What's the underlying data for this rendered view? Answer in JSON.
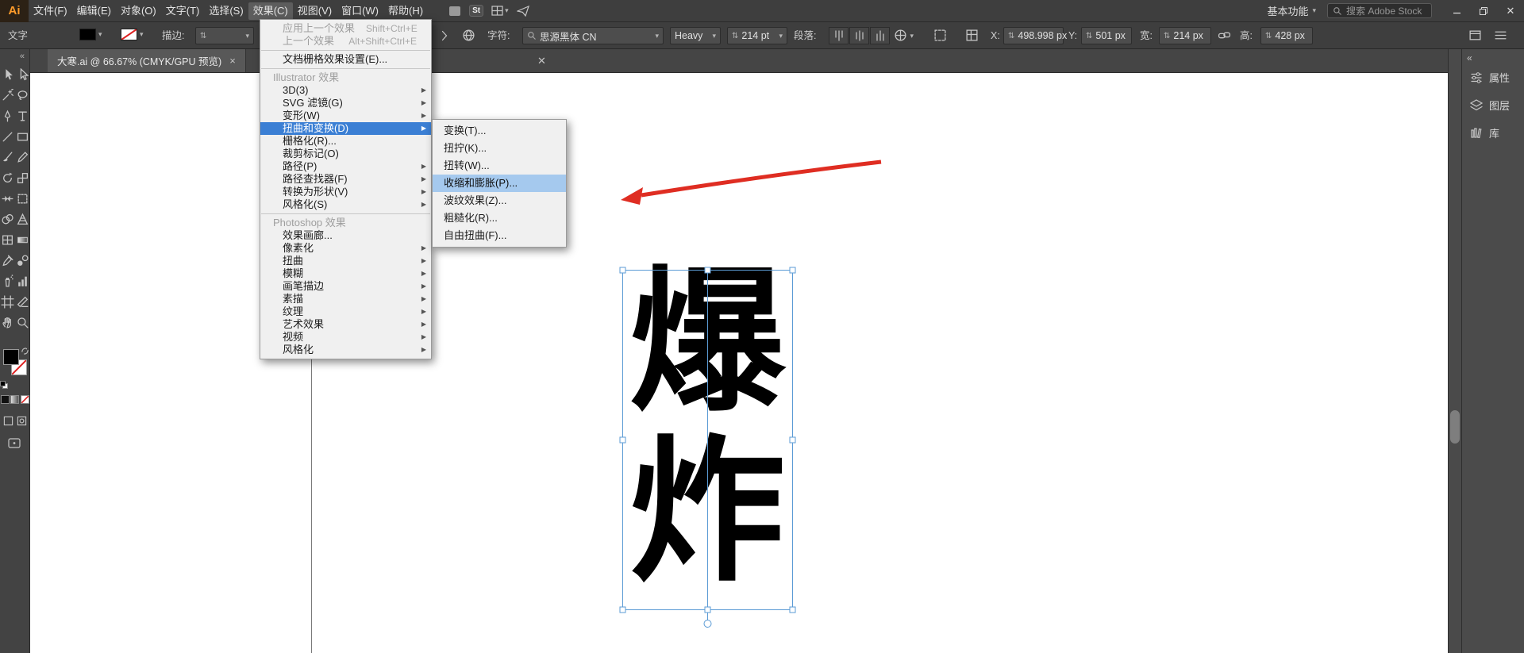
{
  "colors": {
    "menu_highlight": "#3b7fd4",
    "submenu_highlight": "#a5c9ee",
    "arrow_red": "#df2d22",
    "selection_blue": "#5b9bd5"
  },
  "menubar": {
    "logo": "Ai",
    "items": [
      {
        "id": "file",
        "label": "文件(F)"
      },
      {
        "id": "edit",
        "label": "编辑(E)"
      },
      {
        "id": "object",
        "label": "对象(O)"
      },
      {
        "id": "type",
        "label": "文字(T)"
      },
      {
        "id": "select",
        "label": "选择(S)"
      },
      {
        "id": "effect",
        "label": "效果(C)",
        "active": true
      },
      {
        "id": "view",
        "label": "视图(V)"
      },
      {
        "id": "window",
        "label": "窗口(W)"
      },
      {
        "id": "help",
        "label": "帮助(H)"
      }
    ],
    "stock_icon_label": "St",
    "workspace_label": "基本功能",
    "search_placeholder": "搜索 Adobe Stock"
  },
  "controlbar": {
    "context_label": "文字",
    "stroke_label": "描边:",
    "char_label": "字符:",
    "font_name": "思源黑体 CN",
    "font_style": "Heavy",
    "font_size": "214 pt",
    "paragraph_label": "段落:",
    "x_label": "X:",
    "x_value": "498.998 px",
    "y_label": "Y:",
    "y_value": "501 px",
    "w_label": "宽:",
    "w_value": "214 px",
    "h_label": "高:",
    "h_value": "428 px"
  },
  "tabbar": {
    "document_title": "大寒.ai @ 66.67% (CMYK/GPU 预览)"
  },
  "toolbar": {
    "tools": [
      "selection",
      "direct-selection",
      "magic-wand",
      "lasso",
      "pen",
      "type",
      "line-segment",
      "rectangle",
      "paintbrush",
      "pencil",
      "rotate",
      "scale",
      "width",
      "free-transform",
      "shape-builder",
      "perspective-grid",
      "mesh",
      "gradient",
      "eyedropper",
      "blend",
      "symbol-sprayer",
      "column-graph",
      "artboard",
      "slice",
      "hand",
      "zoom"
    ]
  },
  "effect_menu": {
    "items": [
      {
        "id": "apply-last-effect",
        "label": "应用上一个效果",
        "shortcut": "Shift+Ctrl+E",
        "disabled": true
      },
      {
        "id": "last-effect",
        "label": "上一个效果",
        "shortcut": "Alt+Shift+Ctrl+E",
        "disabled": true
      },
      {
        "type": "separator"
      },
      {
        "id": "document-raster-effects-settings",
        "label": "文档栅格效果设置(E)..."
      },
      {
        "type": "separator"
      },
      {
        "type": "header",
        "label": "Illustrator 效果"
      },
      {
        "id": "3d",
        "label": "3D(3)",
        "submenu": true
      },
      {
        "id": "svg-filters",
        "label": "SVG 滤镜(G)",
        "submenu": true
      },
      {
        "id": "warp",
        "label": "变形(W)",
        "submenu": true
      },
      {
        "id": "distort-and-transform",
        "label": "扭曲和变换(D)",
        "submenu": true,
        "selected": true
      },
      {
        "id": "rasterize",
        "label": "栅格化(R)..."
      },
      {
        "id": "crop-marks",
        "label": "裁剪标记(O)"
      },
      {
        "id": "path",
        "label": "路径(P)",
        "submenu": true
      },
      {
        "id": "pathfinder",
        "label": "路径查找器(F)",
        "submenu": true
      },
      {
        "id": "convert-to-shape",
        "label": "转换为形状(V)",
        "submenu": true
      },
      {
        "id": "stylize",
        "label": "风格化(S)",
        "submenu": true
      },
      {
        "type": "separator"
      },
      {
        "type": "header",
        "label": "Photoshop 效果"
      },
      {
        "id": "effect-gallery",
        "label": "效果画廊..."
      },
      {
        "id": "pixelate",
        "label": "像素化",
        "submenu": true
      },
      {
        "id": "distort",
        "label": "扭曲",
        "submenu": true
      },
      {
        "id": "blur",
        "label": "模糊",
        "submenu": true
      },
      {
        "id": "brush-strokes",
        "label": "画笔描边",
        "submenu": true
      },
      {
        "id": "sketch",
        "label": "素描",
        "submenu": true
      },
      {
        "id": "texture",
        "label": "纹理",
        "submenu": true
      },
      {
        "id": "artistic",
        "label": "艺术效果",
        "submenu": true
      },
      {
        "id": "video",
        "label": "视频",
        "submenu": true
      },
      {
        "id": "stylize-ps",
        "label": "风格化",
        "submenu": true
      }
    ]
  },
  "distort_submenu": {
    "items": [
      {
        "id": "transform",
        "label": "变换(T)..."
      },
      {
        "id": "tweak",
        "label": "扭拧(K)..."
      },
      {
        "id": "twist",
        "label": "扭转(W)..."
      },
      {
        "id": "pucker-and-bloat",
        "label": "收缩和膨胀(P)...",
        "selected": true
      },
      {
        "id": "zig-zag",
        "label": "波纹效果(Z)..."
      },
      {
        "id": "roughen",
        "label": "粗糙化(R)..."
      },
      {
        "id": "free-distort",
        "label": "自由扭曲(F)..."
      }
    ]
  },
  "artboard": {
    "char_top": "爆",
    "char_bottom": "炸"
  },
  "dock": {
    "items": [
      {
        "id": "properties",
        "label": "属性"
      },
      {
        "id": "layers",
        "label": "图层"
      },
      {
        "id": "libraries",
        "label": "库"
      }
    ]
  }
}
